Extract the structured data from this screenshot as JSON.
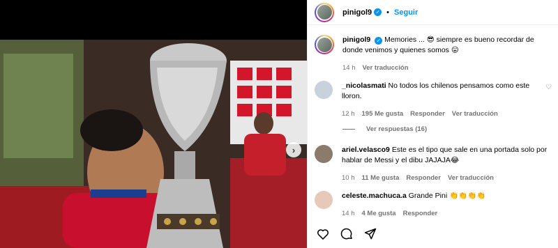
{
  "post": {
    "username": "pinigol9",
    "follow_label": "Seguir",
    "separator": "•"
  },
  "caption": {
    "username": "pinigol9",
    "text": "Memories ... 😎 siempre es bueno recordar de donde venimos y quienes somos 😛",
    "time": "14 h",
    "translate": "Ver traducción"
  },
  "comments": [
    {
      "username": "_nicolasmati",
      "text": "No todos los chilenos pensamos como este lloron.",
      "time": "12 h",
      "likes": "195 Me gusta",
      "reply": "Responder",
      "translate": "Ver traducción",
      "avatar_color": "#c8d2dc"
    },
    {
      "username": "ariel.velasco9",
      "text": "Este es el tipo que sale en una portada solo por hablar de Messi y el dibu JAJAJA😂",
      "time": "10 h",
      "likes": "11 Me gusta",
      "reply": "Responder",
      "translate": "Ver traducción",
      "avatar_color": "#8a7b6a"
    },
    {
      "username": "celeste.machuca.a",
      "text": "Grande Pini 👏👏👏👏",
      "time": "14 h",
      "likes": "4 Me gusta",
      "reply": "Responder",
      "avatar_color": "#e6c9b8"
    }
  ],
  "replies_label": "Ver respuestas (16)",
  "colors": {
    "accent": "#0095f6",
    "meta": "#737373"
  },
  "icons": [
    "heart-icon",
    "comment-icon",
    "share-icon",
    "chevron-right-icon",
    "verified-icon"
  ]
}
